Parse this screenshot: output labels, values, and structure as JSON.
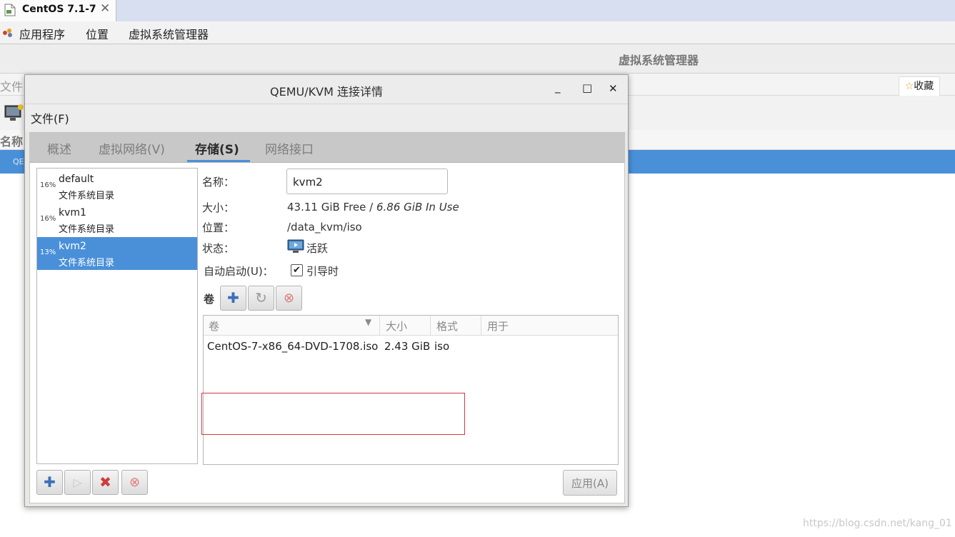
{
  "browser_tab": {
    "title": "CentOS 7.1-7",
    "close": "✕"
  },
  "top_panel": {
    "items": [
      "应用程序",
      "位置",
      "虚拟系统管理器"
    ]
  },
  "background_window": {
    "title": "虚拟系统管理器",
    "menu_file": "文件",
    "favorite_label": "收藏",
    "column_name": "名称",
    "row_text": "QE"
  },
  "dialog": {
    "title": "QEMU/KVM 连接详情",
    "window_buttons": {
      "minimize": "_",
      "maximize": "□",
      "close": "✕"
    },
    "menu_file": "文件(F)",
    "tabs": [
      {
        "label": "概述",
        "active": false
      },
      {
        "label": "虚拟网络(V)",
        "active": false
      },
      {
        "label": "存储(S)",
        "active": true
      },
      {
        "label": "网络接口",
        "active": false
      }
    ],
    "pools": [
      {
        "pct": "16%",
        "name": "default",
        "type": "文件系统目录",
        "selected": false
      },
      {
        "pct": "16%",
        "name": "kvm1",
        "type": "文件系统目录",
        "selected": false
      },
      {
        "pct": "13%",
        "name": "kvm2",
        "type": "文件系统目录",
        "selected": true
      }
    ],
    "details": {
      "name_label": "名称：",
      "name_value": "kvm2",
      "size_label": "大小：",
      "size_free": "43.11 GiB Free",
      "size_sep": " / ",
      "size_used": "6.86 GiB In Use",
      "location_label": "位置：",
      "location_value": "/data_kvm/iso",
      "state_label": "状态：",
      "state_value": "活跃",
      "autostart_label": "自动启动(U)：",
      "autostart_value": "引导时",
      "autostart_checked": true,
      "volumes_label": "卷"
    },
    "volume_table": {
      "columns": [
        "卷",
        "大小",
        "格式",
        "用于"
      ],
      "rows": [
        {
          "name": "CentOS-7-x86_64-DVD-1708.iso",
          "size": "2.43 GiB",
          "format": "iso",
          "used_by": ""
        }
      ]
    },
    "apply_label": "应用(A)"
  },
  "watermark": "https://blog.csdn.net/kang_01",
  "colors": {
    "accent": "#4a90d9",
    "highlight_box": "#d9363e",
    "delete_red": "#d23a3a"
  }
}
